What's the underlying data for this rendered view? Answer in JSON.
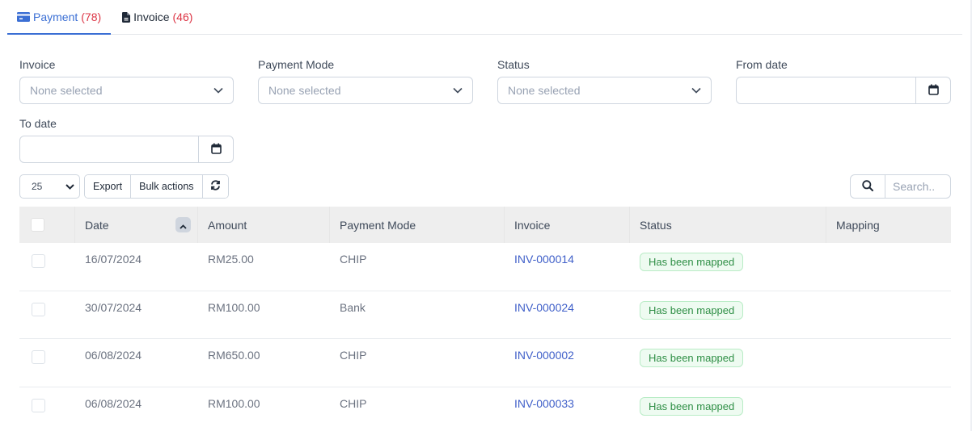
{
  "tabs": [
    {
      "label": "Payment",
      "count": "(78)",
      "icon": "credit-card-icon",
      "active": true
    },
    {
      "label": "Invoice",
      "count": "(46)",
      "icon": "file-icon",
      "active": false
    }
  ],
  "filters": {
    "invoice": {
      "label": "Invoice",
      "placeholder": "None selected"
    },
    "payment_mode": {
      "label": "Payment Mode",
      "placeholder": "None selected"
    },
    "status": {
      "label": "Status",
      "placeholder": "None selected"
    },
    "from_date": {
      "label": "From date",
      "value": ""
    },
    "to_date": {
      "label": "To date",
      "value": ""
    }
  },
  "toolbar": {
    "page_size": "25",
    "export_label": "Export",
    "bulk_actions_label": "Bulk actions",
    "refresh_icon": "refresh-icon",
    "search_placeholder": "Search.."
  },
  "table": {
    "columns": [
      "",
      "Date",
      "Amount",
      "Payment Mode",
      "Invoice",
      "Status",
      "Mapping"
    ],
    "sort": {
      "column": "Date",
      "direction": "ascending"
    },
    "rows": [
      {
        "date": "16/07/2024",
        "amount": "RM25.00",
        "mode": "CHIP",
        "invoice": "INV-000014",
        "status": "Has been mapped",
        "mapping": ""
      },
      {
        "date": "30/07/2024",
        "amount": "RM100.00",
        "mode": "Bank",
        "invoice": "INV-000024",
        "status": "Has been mapped",
        "mapping": ""
      },
      {
        "date": "06/08/2024",
        "amount": "RM650.00",
        "mode": "CHIP",
        "invoice": "INV-000002",
        "status": "Has been mapped",
        "mapping": ""
      },
      {
        "date": "06/08/2024",
        "amount": "RM100.00",
        "mode": "CHIP",
        "invoice": "INV-000033",
        "status": "Has been mapped",
        "mapping": ""
      }
    ]
  },
  "colors": {
    "accent": "#3b6fd4",
    "count": "#dc3545",
    "link": "#4060c9",
    "badge_text": "#2f8f46",
    "badge_bg": "#eefbf1",
    "header_bg": "#eeeeee"
  }
}
